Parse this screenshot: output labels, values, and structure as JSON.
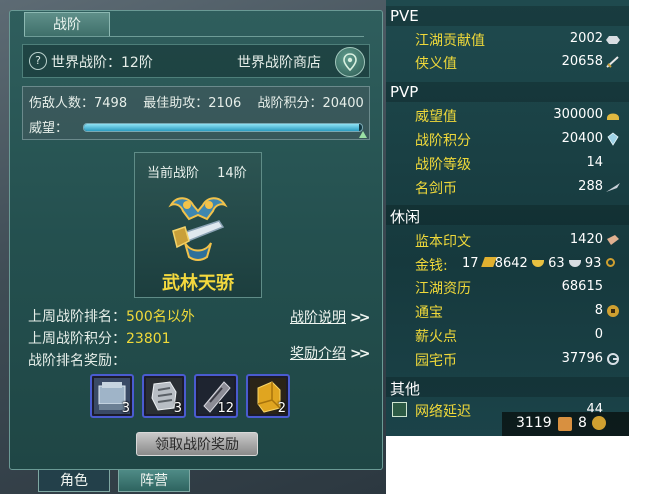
{
  "left_panel": {
    "tab_label": "战阶",
    "world_rank": "世界战阶：12阶",
    "world_shop": "世界战阶商店",
    "stats": {
      "enemies_hurt": "伤敌人数：7498",
      "best_assist": "最佳助攻：2106",
      "rank_points": "战阶积分：20400"
    },
    "prestige_label": "威望：",
    "prestige_progress": 0.99,
    "current_rank": {
      "label": "当前战阶",
      "level": "14阶",
      "title": "武林天骄"
    },
    "last_week_rank_label": "上周战阶排名：",
    "last_week_rank_value": "500名以外",
    "last_week_points_label": "上周战阶积分：",
    "last_week_points_value": "23801",
    "reward_label": "战阶排名奖励：",
    "rank_help_link": "战阶说明",
    "reward_intro_link": "奖励介绍",
    "rewards": [
      {
        "icon": "armor-chest-icon",
        "count": "3"
      },
      {
        "icon": "gauntlet-icon",
        "count": "3"
      },
      {
        "icon": "scroll-talisman-icon",
        "count": "12"
      },
      {
        "icon": "gold-bar-icon",
        "count": "2"
      }
    ],
    "claim_button": "领取战阶奖励",
    "bottom_tabs": [
      "角色",
      "阵营"
    ]
  },
  "right_panel": {
    "pve": {
      "header": "PVE",
      "rows": [
        {
          "label": "江湖贡献值",
          "value": "2002",
          "icon": "ingot-icon"
        },
        {
          "label": "侠义值",
          "value": "20658",
          "icon": "sword-icon"
        }
      ]
    },
    "pvp": {
      "header": "PVP",
      "rows": [
        {
          "label": "威望值",
          "value": "300000",
          "icon": "helmet-icon"
        },
        {
          "label": "战阶积分",
          "value": "20400",
          "icon": "crystal-icon"
        },
        {
          "label": "战阶等级",
          "value": "14",
          "icon": ""
        },
        {
          "label": "名剑币",
          "value": "288",
          "icon": "feather-blade-icon"
        }
      ]
    },
    "leisure": {
      "header": "休闲",
      "rows": [
        {
          "label": "监本印文",
          "value": "1420",
          "icon": "seal-icon"
        },
        {
          "label": "江湖资历",
          "value": "68615",
          "icon": ""
        },
        {
          "label": "通宝",
          "value": "8",
          "icon": "coin-icon"
        },
        {
          "label": "薪火点",
          "value": "0",
          "icon": ""
        },
        {
          "label": "园宅币",
          "value": "37796",
          "icon": "house-coin-icon"
        }
      ],
      "money_label": "金钱:",
      "money": {
        "gold_brick": "17",
        "gold": "8642",
        "silver": "63",
        "copper": "93"
      }
    },
    "other": {
      "header": "其他",
      "rows": [
        {
          "label": "网络延迟",
          "value": "44"
        }
      ]
    },
    "bottom_bar": {
      "points": "3119",
      "tongbao": "8"
    }
  },
  "colors": {
    "accent_yellow": "#f0d93a",
    "rank_title": "#f4d93e",
    "panel_teal": "#24504f"
  }
}
